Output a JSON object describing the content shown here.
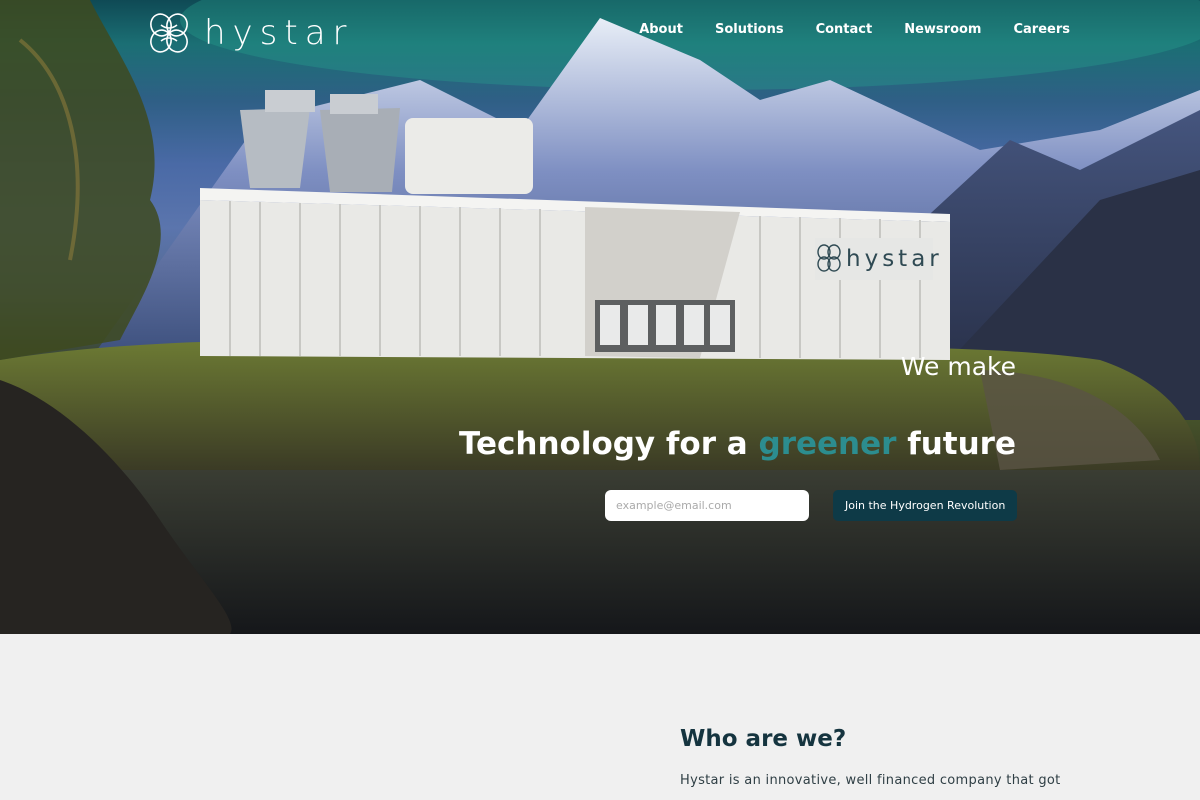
{
  "brand": {
    "name": "hystar",
    "container_label": "hystar"
  },
  "nav": {
    "items": [
      {
        "label": "About"
      },
      {
        "label": "Solutions"
      },
      {
        "label": "Contact"
      },
      {
        "label": "Newsroom"
      },
      {
        "label": "Careers"
      }
    ]
  },
  "hero": {
    "kicker": "We make",
    "headline_pre": "Technology for a ",
    "headline_accent": "greener",
    "headline_post": " future",
    "email_placeholder": "example@email.com",
    "cta_label": "Join the Hydrogen Revolution"
  },
  "about": {
    "title": "Who are we?",
    "body": "Hystar is an innovative, well financed company that got"
  },
  "colors": {
    "accent": "#2c8d8f",
    "cta_bg": "#0e3a47",
    "section_bg": "#f0f0f0",
    "title_dark": "#15343f"
  }
}
